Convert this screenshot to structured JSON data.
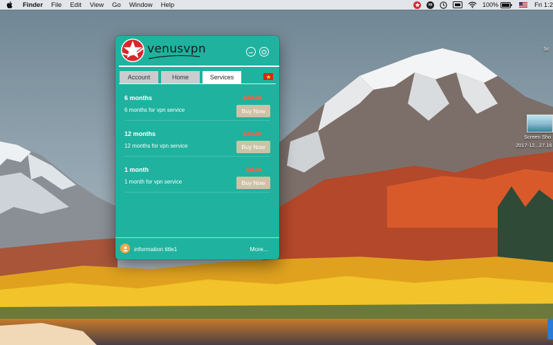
{
  "menubar": {
    "app_name": "Finder",
    "menus": [
      "File",
      "Edit",
      "View",
      "Go",
      "Window",
      "Help"
    ],
    "battery_text": "100%",
    "clock_text": "Fri 1:2",
    "status_icons": [
      "venusvpn-icon",
      "vpn-status-icon",
      "clock-icon",
      "cards-icon",
      "wifi-icon",
      "battery-icon",
      "flag-icon"
    ]
  },
  "desktop": {
    "file_label_line1": "Screen Sho",
    "file_label_line2": "2017-12...27.16",
    "sliver_label": "Sc"
  },
  "vpn": {
    "logo_text": "venusvpn",
    "tabs": [
      {
        "label": "Account",
        "active": false
      },
      {
        "label": "Home",
        "active": false
      },
      {
        "label": "Services",
        "active": true
      }
    ],
    "services": [
      {
        "name": "6 months",
        "price": "$33.99",
        "description": "6 months for vpn service",
        "button": "Buy Now"
      },
      {
        "name": "12 months",
        "price": "$71.88",
        "description": "12 months for vpn service",
        "button": "Buy Now"
      },
      {
        "name": "1 month",
        "price": "$8.99",
        "description": "1 month for vpn service",
        "button": "Buy Now"
      }
    ],
    "footer": {
      "info_text": "information title1",
      "more_label": "More..."
    }
  },
  "colors": {
    "accent": "#1fb29f",
    "price_strike": "#ff5c45",
    "buy_button": "#cbc3a6",
    "tab_inactive": "#c9cdd0"
  }
}
